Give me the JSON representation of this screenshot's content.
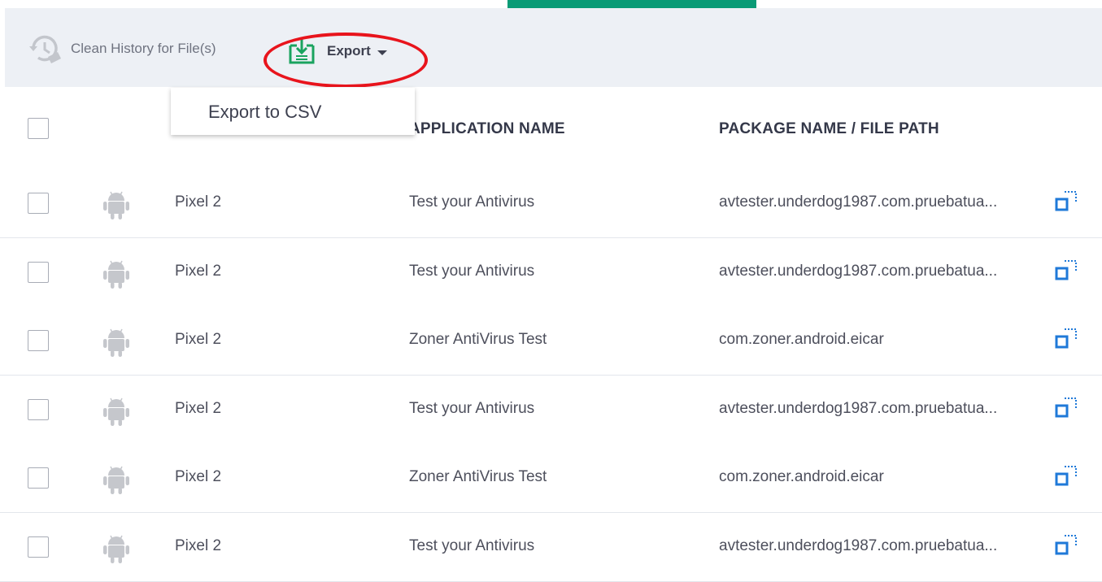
{
  "toolbar": {
    "clean_history_label": "Clean History for File(s)",
    "clean_history_icon": "clean-history-icon",
    "export_label": "Export",
    "export_icon": "export-download-icon"
  },
  "export_menu": {
    "items": [
      "Export to CSV"
    ]
  },
  "table": {
    "columns": [
      "APPLICATION NAME",
      "PACKAGE NAME / FILE PATH"
    ],
    "rows": [
      {
        "device": "Pixel 2",
        "app": "Test your Antivirus",
        "package": "avtester.underdog1987.com.pruebatua..."
      },
      {
        "device": "Pixel 2",
        "app": "Test your Antivirus",
        "package": "avtester.underdog1987.com.pruebatua..."
      },
      {
        "device": "Pixel 2",
        "app": "Zoner AntiVirus Test",
        "package": "com.zoner.android.eicar"
      },
      {
        "device": "Pixel 2",
        "app": "Test your Antivirus",
        "package": "avtester.underdog1987.com.pruebatua..."
      },
      {
        "device": "Pixel 2",
        "app": "Zoner AntiVirus Test",
        "package": "com.zoner.android.eicar"
      },
      {
        "device": "Pixel 2",
        "app": "Test your Antivirus",
        "package": "avtester.underdog1987.com.pruebatua..."
      }
    ]
  },
  "colors": {
    "accent_green": "#0a9b76",
    "highlight_red": "#e8141c",
    "toolbar_bg": "#edf0f5",
    "copy_icon_blue": "#1f79d8",
    "android_gray": "#c5c7cc"
  }
}
